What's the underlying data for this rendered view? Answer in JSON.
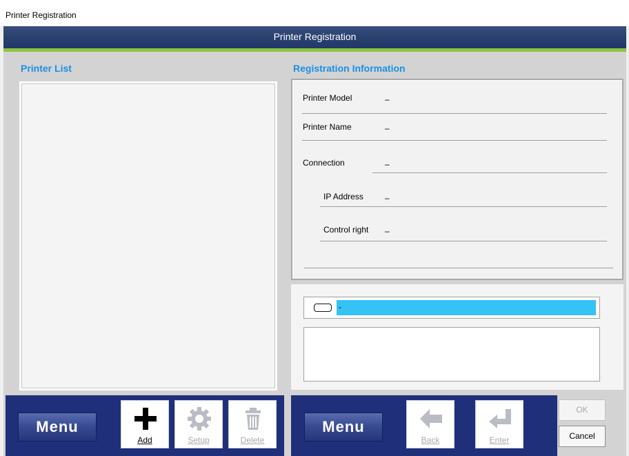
{
  "window": {
    "title": "Printer Registration"
  },
  "header": {
    "title": "Printer Registration"
  },
  "printer_list": {
    "title": "Printer List",
    "items": []
  },
  "registration": {
    "title": "Registration Information",
    "fields": [
      {
        "label": "Printer Model",
        "value": "–"
      },
      {
        "label": "Printer Name",
        "value": "–"
      },
      {
        "label": "Connection",
        "value": "–"
      },
      {
        "label": "IP Address",
        "value": "–"
      },
      {
        "label": "Control right",
        "value": "–"
      }
    ]
  },
  "status": {
    "text": "-",
    "bar_color": "#35c2f4",
    "message": ""
  },
  "left_toolbar": {
    "menu_label": "Menu",
    "add_label": "Add",
    "setup_label": "Setup",
    "delete_label": "Delete"
  },
  "right_toolbar": {
    "menu_label": "Menu",
    "back_label": "Back",
    "enter_label": "Enter"
  },
  "dialog": {
    "ok_label": "OK",
    "cancel_label": "Cancel"
  },
  "colors": {
    "header": "#2a4170",
    "accent_line": "#8cc440",
    "navbar": "#1f2f7a",
    "section_title": "#1b8fe6"
  }
}
